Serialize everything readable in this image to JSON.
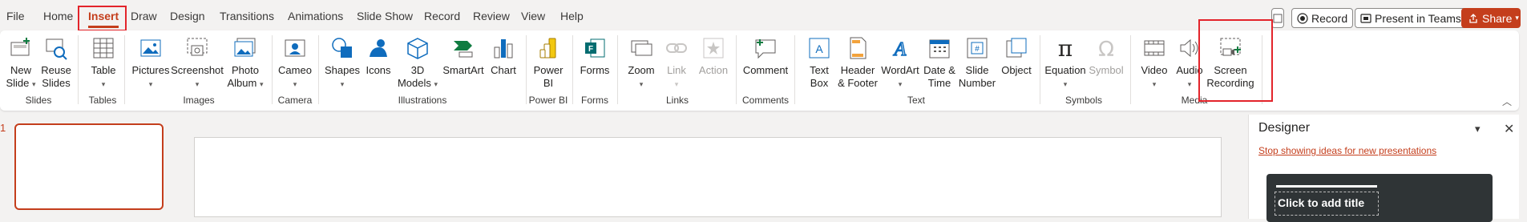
{
  "menu": {
    "tabs": [
      "File",
      "Home",
      "Insert",
      "Draw",
      "Design",
      "Transitions",
      "Animations",
      "Slide Show",
      "Record",
      "Review",
      "View",
      "Help"
    ],
    "active_tab": "Insert",
    "record_label": "Record",
    "present_label": "Present in Teams",
    "share_label": "Share"
  },
  "ribbon": {
    "groups": {
      "slides": "Slides",
      "tables": "Tables",
      "images": "Images",
      "camera": "Camera",
      "illustrations": "Illustrations",
      "powerbi": "Power BI",
      "forms": "Forms",
      "links": "Links",
      "comments": "Comments",
      "text": "Text",
      "symbols": "Symbols",
      "media": "Media"
    },
    "commands": {
      "new_slide": [
        "New",
        "Slide"
      ],
      "reuse_slides": [
        "Reuse",
        "Slides"
      ],
      "table": [
        "Table"
      ],
      "pictures": [
        "Pictures"
      ],
      "screenshot": [
        "Screenshot"
      ],
      "photo_album": [
        "Photo",
        "Album"
      ],
      "cameo": [
        "Cameo"
      ],
      "shapes": [
        "Shapes"
      ],
      "icons": [
        "Icons"
      ],
      "models_3d": [
        "3D",
        "Models"
      ],
      "smartart": [
        "SmartArt"
      ],
      "chart": [
        "Chart"
      ],
      "power_bi": [
        "Power",
        "BI"
      ],
      "forms": [
        "Forms"
      ],
      "zoom": [
        "Zoom"
      ],
      "link": [
        "Link"
      ],
      "action": [
        "Action"
      ],
      "comment": [
        "Comment"
      ],
      "text_box": [
        "Text",
        "Box"
      ],
      "header_footer": [
        "Header",
        "& Footer"
      ],
      "wordart": [
        "WordArt"
      ],
      "date_time": [
        "Date &",
        "Time"
      ],
      "slide_number": [
        "Slide",
        "Number"
      ],
      "object": [
        "Object"
      ],
      "equation": [
        "Equation"
      ],
      "symbol": [
        "Symbol"
      ],
      "video": [
        "Video"
      ],
      "audio": [
        "Audio"
      ],
      "screen_recording": [
        "Screen",
        "Recording"
      ]
    }
  },
  "slides_pane": {
    "slide_number": "1"
  },
  "designer": {
    "title": "Designer",
    "link": "Stop showing ideas for new presentations",
    "card_text": "Click to add title"
  },
  "colors": {
    "accent": "#c43e1c",
    "highlight": "#e3242b"
  }
}
